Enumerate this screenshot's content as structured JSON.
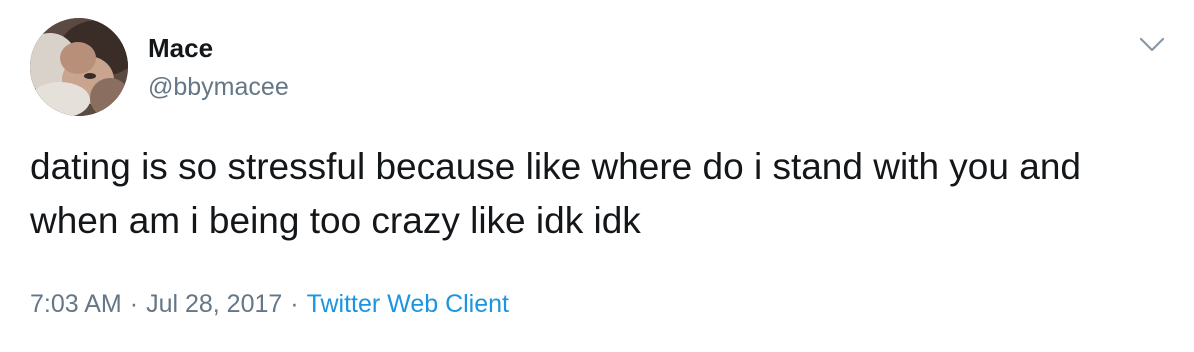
{
  "user": {
    "display_name": "Mace",
    "handle": "@bbymacee"
  },
  "tweet": {
    "text": "dating is so stressful because like where do i stand with you and when am i being too crazy like idk idk",
    "time": "7:03 AM",
    "date": "Jul 28, 2017",
    "separator": "·",
    "source": "Twitter Web Client"
  },
  "icons": {
    "menu": "chevron-down-icon"
  },
  "colors": {
    "text": "#14171a",
    "secondary": "#657786",
    "link": "#1b95e0"
  }
}
